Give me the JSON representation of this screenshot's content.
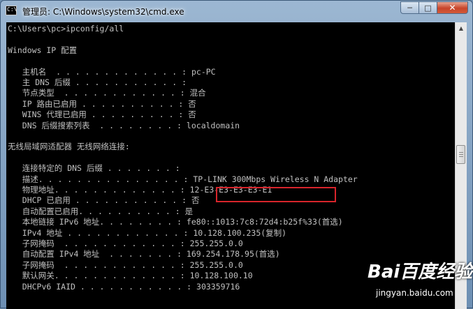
{
  "window": {
    "title": "管理员: C:\\Windows\\system32\\cmd.exe",
    "icon_text": "C:\\"
  },
  "controls": {
    "minimize": "─",
    "maximize": "□",
    "close": "✕"
  },
  "console": {
    "lines": [
      "C:\\Users\\pc>ipconfig/all",
      "",
      "Windows IP 配置",
      "",
      "   主机名  . . . . . . . . . . . . . : pc-PC",
      "   主 DNS 后缀 . . . . . . . . . . . :",
      "   节点类型  . . . . . . . . . . . . : 混合",
      "   IP 路由已启用 . . . . . . . . . . : 否",
      "   WINS 代理已启用 . . . . . . . . . : 否",
      "   DNS 后缀搜索列表  . . . . . . . . : localdomain",
      "",
      "无线局域网适配器 无线网络连接:",
      "",
      "   连接特定的 DNS 后缀 . . . . . . . :",
      "   描述. . . . . . . . . . . . . . . : TP-LINK 300Mbps Wireless N Adapter",
      "   物理地址. . . . . . . . . . . . . : 12-E3-E3-E3-E3-E1",
      "   DHCP 已启用 . . . . . . . . . . . : 否",
      "   自动配置已启用. . . . . . . . . . : 是",
      "   本地链接 IPv6 地址. . . . . . . . : fe80::1013:7c8:72d4:b25f%33(首选)",
      "   IPv4 地址 . . . . . . . . . . . . : 10.128.100.235(复制)",
      "   子网掩码  . . . . . . . . . . . . : 255.255.0.0",
      "   自动配置 IPv4 地址  . . . . . . . : 169.254.178.95(首选)",
      "   子网掩码  . . . . . . . . . . . . : 255.255.0.0",
      "   默认网关. . . . . . . . . . . . . : 10.128.100.10",
      "   DHCPv6 IAID . . . . . . . . . . . : 303359716"
    ]
  },
  "watermark": {
    "logo": "Bai百度经验",
    "url": "jingyan.baidu.com"
  }
}
